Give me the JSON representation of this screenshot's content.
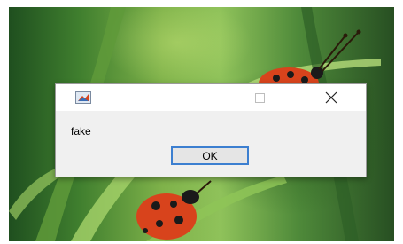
{
  "dialog": {
    "title_icon": "app-icon",
    "controls": [
      "minimize-icon",
      "maximize-icon",
      "close-icon"
    ],
    "message": "fake",
    "ok_label": "OK"
  },
  "colors": {
    "dialog_bg": "#f0f0f0",
    "titlebar_bg": "#ffffff",
    "button_border": "#3c7fd0",
    "ladybug": "#d8431c"
  }
}
